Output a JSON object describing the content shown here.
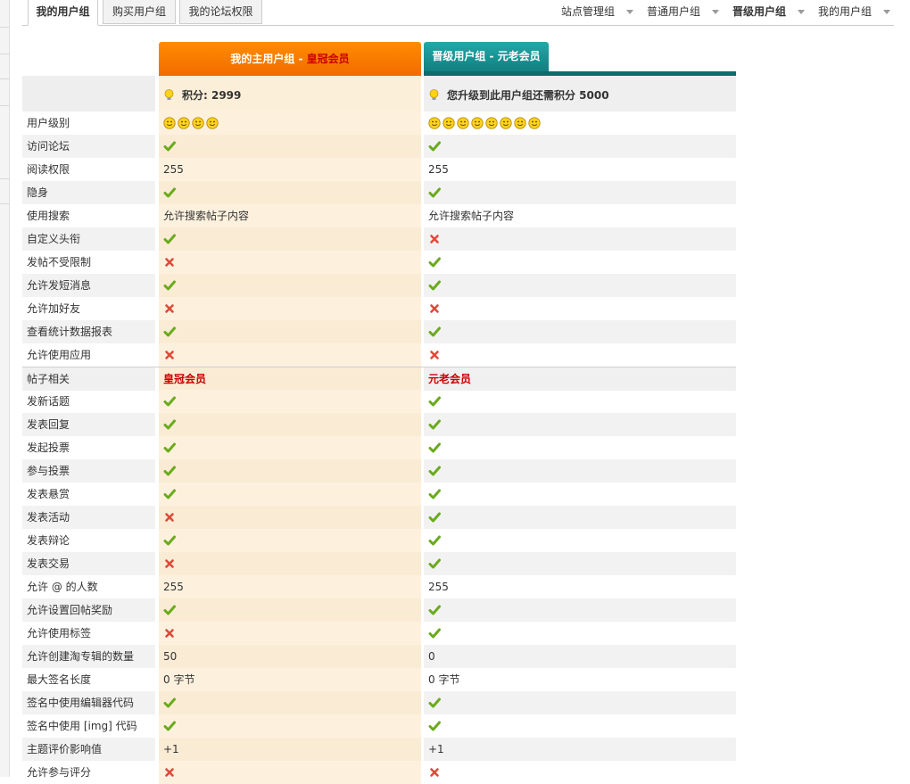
{
  "tabs": [
    {
      "label": "我的用户组",
      "active": true
    },
    {
      "label": "购买用户组",
      "active": false
    },
    {
      "label": "我的论坛权限",
      "active": false
    }
  ],
  "right_nav": [
    {
      "label": "站点管理组",
      "bold": false
    },
    {
      "label": "普通用户组",
      "bold": false
    },
    {
      "label": "晋级用户组",
      "bold": true
    },
    {
      "label": "我的用户组",
      "bold": false
    }
  ],
  "main_group": {
    "header_prefix": "我的主用户组 - ",
    "header_name": "皇冠会员",
    "points_text": "积分: 2999",
    "stars": 4
  },
  "upgrade_group": {
    "header": "晋级用户组 - 元老会员",
    "points_text": "您升级到此用户组还需积分 5000",
    "stars": 8
  },
  "colors": {
    "accent_orange": "#f57a00",
    "accent_teal": "#1a9a9a",
    "check_green": "#6aab1c",
    "cross_red": "#e04a3a"
  },
  "rows": [
    {
      "label": "用户级别",
      "main": "",
      "upg": "",
      "type": "stars"
    },
    {
      "label": "访问论坛",
      "main": "check",
      "upg": "check"
    },
    {
      "label": "阅读权限",
      "main": "255",
      "upg": "255"
    },
    {
      "label": "隐身",
      "main": "check",
      "upg": "check"
    },
    {
      "label": "使用搜索",
      "main": "允许搜索帖子内容",
      "upg": "允许搜索帖子内容"
    },
    {
      "label": "自定义头衔",
      "main": "check",
      "upg": "cross"
    },
    {
      "label": "发帖不受限制",
      "main": "cross",
      "upg": "check"
    },
    {
      "label": "允许发短消息",
      "main": "check",
      "upg": "check"
    },
    {
      "label": "允许加好友",
      "main": "cross",
      "upg": "cross"
    },
    {
      "label": "查看统计数据报表",
      "main": "check",
      "upg": "check"
    },
    {
      "label": "允许使用应用",
      "main": "cross",
      "upg": "cross"
    },
    {
      "label": "帖子相关",
      "main": "皇冠会员",
      "upg": "元老会员",
      "type": "section"
    },
    {
      "label": "发新话题",
      "main": "check",
      "upg": "check"
    },
    {
      "label": "发表回复",
      "main": "check",
      "upg": "check"
    },
    {
      "label": "发起投票",
      "main": "check",
      "upg": "check"
    },
    {
      "label": "参与投票",
      "main": "check",
      "upg": "check"
    },
    {
      "label": "发表悬赏",
      "main": "check",
      "upg": "check"
    },
    {
      "label": "发表活动",
      "main": "cross",
      "upg": "check"
    },
    {
      "label": "发表辩论",
      "main": "check",
      "upg": "check"
    },
    {
      "label": "发表交易",
      "main": "cross",
      "upg": "check"
    },
    {
      "label": "允许 @ 的人数",
      "main": "255",
      "upg": "255"
    },
    {
      "label": "允许设置回帖奖励",
      "main": "check",
      "upg": "check"
    },
    {
      "label": "允许使用标签",
      "main": "cross",
      "upg": "check"
    },
    {
      "label": "允许创建淘专辑的数量",
      "main": "50",
      "upg": "0"
    },
    {
      "label": "最大签名长度",
      "main": "0 字节",
      "upg": "0 字节"
    },
    {
      "label": "签名中使用编辑器代码",
      "main": "check",
      "upg": "check"
    },
    {
      "label": "签名中使用 [img] 代码",
      "main": "check",
      "upg": "check"
    },
    {
      "label": "主题评价影响值",
      "main": "+1",
      "upg": "+1"
    },
    {
      "label": "允许参与评分",
      "main": "cross",
      "upg": "cross"
    }
  ]
}
